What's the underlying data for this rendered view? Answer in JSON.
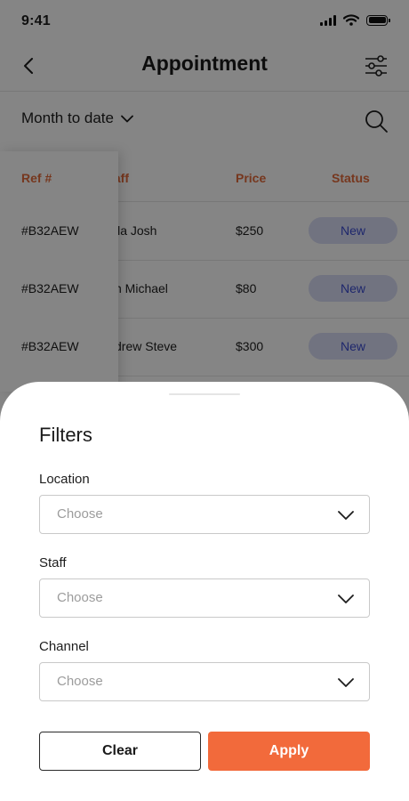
{
  "status_bar": {
    "time": "9:41"
  },
  "header": {
    "title": "Appointment"
  },
  "toolbar": {
    "period": "Month to date"
  },
  "table": {
    "columns": {
      "ref": "Ref #",
      "staff": "Staff",
      "price": "Price",
      "status": "Status"
    },
    "rows": [
      {
        "ref": "#B32AEW",
        "staff_visible": "lla Josh",
        "price": "$250",
        "status": "New"
      },
      {
        "ref": "#B32AEW",
        "staff_visible": "n Michael",
        "price": "$80",
        "status": "New"
      },
      {
        "ref": "#B32AEW",
        "staff_visible": "drew Steve",
        "price": "$300",
        "status": "New"
      }
    ]
  },
  "filters": {
    "title": "Filters",
    "fields": [
      {
        "label": "Location",
        "placeholder": "Choose"
      },
      {
        "label": "Staff",
        "placeholder": "Choose"
      },
      {
        "label": "Channel",
        "placeholder": "Choose"
      }
    ],
    "clear_label": "Clear",
    "apply_label": "Apply"
  },
  "colors": {
    "accent": "#f26a3b",
    "header_text": "#e36a3a",
    "badge_bg": "#d8dcf6",
    "badge_text": "#3b4bd0",
    "overlay": "rgba(0,0,0,0.48)"
  },
  "icons": [
    "back-arrow-icon",
    "filter-sliders-icon",
    "chevron-down-icon",
    "search-icon",
    "signal-icon",
    "wifi-icon",
    "battery-icon"
  ]
}
